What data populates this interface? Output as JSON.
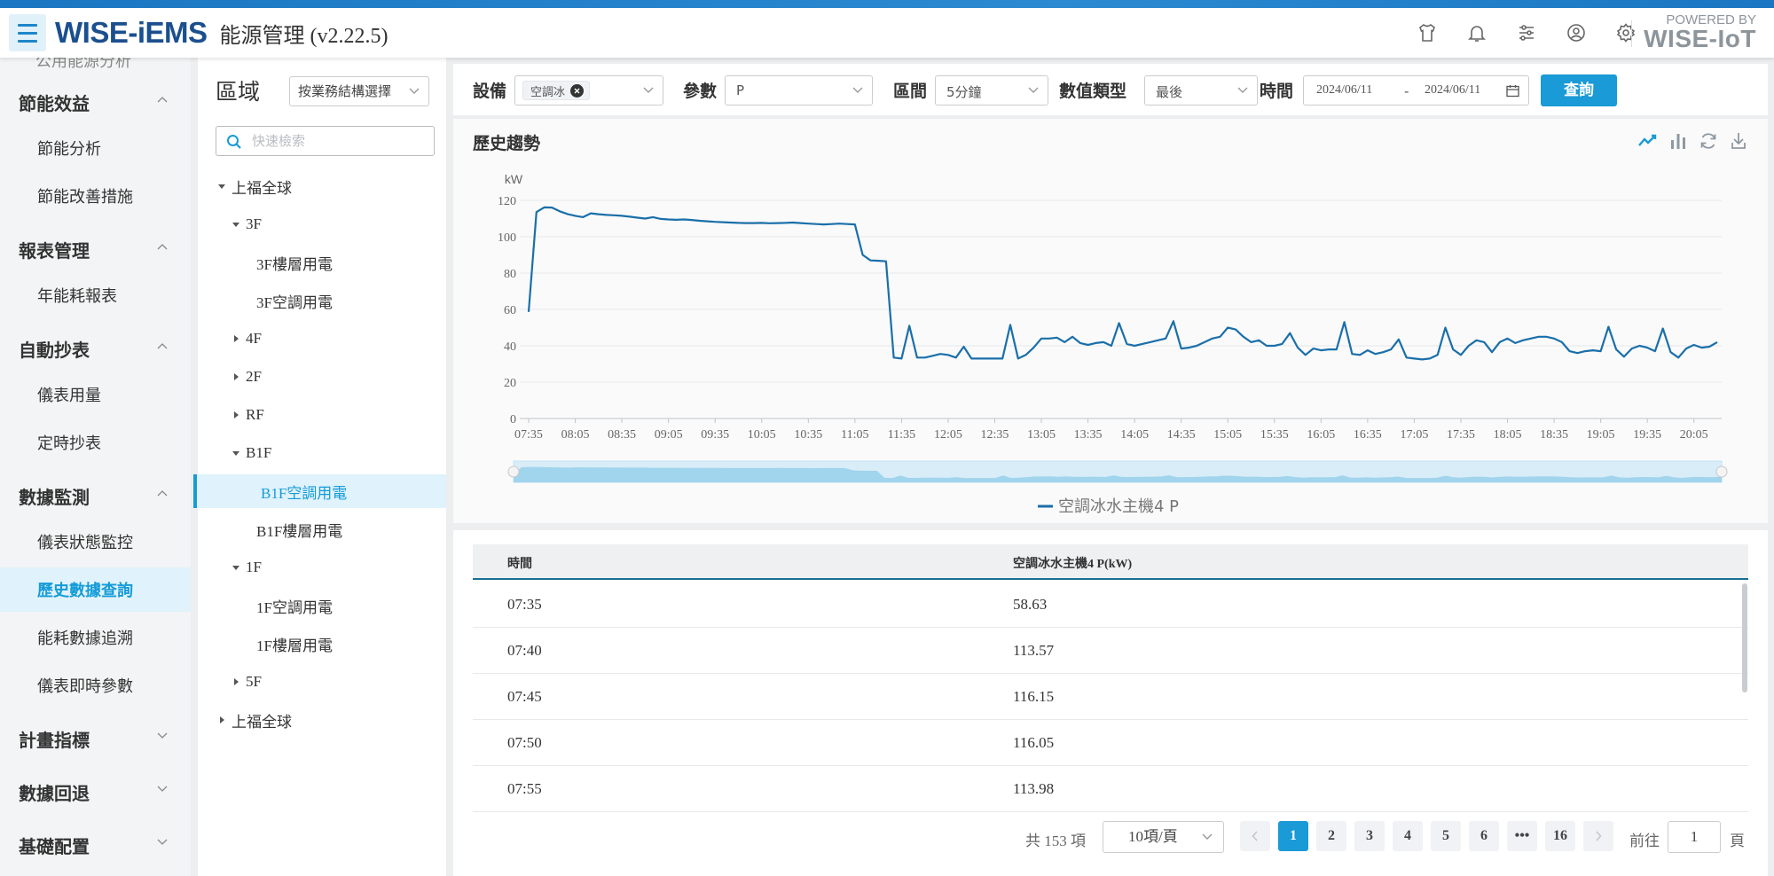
{
  "header": {
    "logo": "WISE-iEMS",
    "app_title": "能源管理 (v2.22.5)",
    "powered_line1": "POWERED BY",
    "powered_line2": "WISE-IoT"
  },
  "sidebar": {
    "cut_item": "公用能源分析",
    "sections": [
      {
        "label": "節能效益",
        "expanded": true,
        "items": [
          "節能分析",
          "節能改善措施"
        ]
      },
      {
        "label": "報表管理",
        "expanded": true,
        "items": [
          "年能耗報表"
        ]
      },
      {
        "label": "自動抄表",
        "expanded": true,
        "items": [
          "儀表用量",
          "定時抄表"
        ]
      },
      {
        "label": "數據監測",
        "expanded": true,
        "items": [
          "儀表狀態監控",
          "歷史數據查詢",
          "能耗數據追溯",
          "儀表即時參數"
        ]
      },
      {
        "label": "計畫指標",
        "expanded": false,
        "items": []
      },
      {
        "label": "數據回退",
        "expanded": false,
        "items": []
      },
      {
        "label": "基礎配置",
        "expanded": false,
        "items": []
      }
    ],
    "active_item": "歷史數據查詢"
  },
  "region": {
    "title": "區域",
    "select_value": "按業務結構選擇",
    "search_placeholder": "快速檢索",
    "tree": [
      {
        "label": "上福全球",
        "level": 0,
        "state": "expanded"
      },
      {
        "label": "3F",
        "level": 1,
        "state": "expanded"
      },
      {
        "label": "3F樓層用電",
        "level": 2,
        "state": "leaf"
      },
      {
        "label": "3F空調用電",
        "level": 2,
        "state": "leaf"
      },
      {
        "label": "4F",
        "level": 1,
        "state": "collapsed"
      },
      {
        "label": "2F",
        "level": 1,
        "state": "collapsed"
      },
      {
        "label": "RF",
        "level": 1,
        "state": "collapsed"
      },
      {
        "label": "B1F",
        "level": 1,
        "state": "expanded"
      },
      {
        "label": "B1F空調用電",
        "level": 2,
        "state": "leaf",
        "active": true
      },
      {
        "label": "B1F樓層用電",
        "level": 2,
        "state": "leaf"
      },
      {
        "label": "1F",
        "level": 1,
        "state": "expanded"
      },
      {
        "label": "1F空調用電",
        "level": 2,
        "state": "leaf"
      },
      {
        "label": "1F樓層用電",
        "level": 2,
        "state": "leaf"
      },
      {
        "label": "5F",
        "level": 1,
        "state": "collapsed"
      },
      {
        "label": "上福全球",
        "level": 0,
        "state": "collapsed"
      }
    ]
  },
  "filters": {
    "device_label": "設備",
    "device_tag": "空調冰",
    "param_label": "參數",
    "param_value": "P",
    "interval_label": "區間",
    "interval_value": "5分鐘",
    "value_type_label": "數值類型",
    "value_type_value": "最後",
    "time_label": "時間",
    "date_from": "2024/06/11",
    "date_sep": "-",
    "date_to": "2024/06/11",
    "query_button": "查詢"
  },
  "chart_card": {
    "title": "歷史趨勢",
    "tool_icons": [
      "line-chart-icon",
      "bar-chart-icon",
      "refresh-icon",
      "download-icon"
    ]
  },
  "chart_data": {
    "type": "line",
    "title": "",
    "ylabel": "kW",
    "xlabel": "",
    "ylim": [
      0,
      120
    ],
    "yticks": [
      0,
      20,
      40,
      60,
      80,
      100,
      120
    ],
    "xtick_labels": [
      "07:35",
      "08:05",
      "08:35",
      "09:05",
      "09:35",
      "10:05",
      "10:35",
      "11:05",
      "11:35",
      "12:05",
      "12:35",
      "13:05",
      "13:35",
      "14:05",
      "14:35",
      "15:05",
      "15:35",
      "16:05",
      "16:35",
      "17:05",
      "17:35",
      "18:05",
      "18:35",
      "19:05",
      "19:35",
      "20:05"
    ],
    "legend": "bottom-center",
    "grid": true,
    "series": [
      {
        "name": "空調冰水主機4 P",
        "color": "#1a6fa9",
        "start": "07:35",
        "step_minutes": 5,
        "values": [
          58.63,
          113.57,
          116.15,
          116.05,
          113.98,
          112.5,
          111.5,
          110.8,
          112.9,
          112.4,
          112.0,
          111.8,
          111.5,
          111.0,
          110.5,
          110.0,
          110.8,
          109.8,
          109.5,
          109.3,
          109.5,
          109.2,
          108.8,
          108.5,
          108.2,
          108.0,
          107.8,
          107.6,
          107.5,
          107.5,
          107.6,
          107.4,
          107.5,
          107.6,
          107.8,
          107.5,
          107.2,
          107.0,
          106.8,
          107.0,
          107.2,
          107.0,
          106.8,
          90.0,
          87.0,
          86.8,
          86.5,
          33.5,
          33.0,
          51.0,
          33.5,
          33.5,
          34.5,
          35.5,
          35.0,
          33.5,
          39.5,
          33.0,
          33.0,
          33.0,
          33.0,
          33.0,
          51.5,
          33.0,
          35.0,
          39.0,
          44.0,
          44.0,
          44.5,
          42.0,
          45.0,
          41.5,
          40.5,
          41.5,
          42.0,
          40.0,
          52.5,
          41.0,
          40.0,
          41.0,
          42.0,
          43.0,
          44.0,
          53.5,
          38.5,
          39.0,
          40.0,
          42.0,
          44.0,
          45.0,
          50.0,
          49.0,
          45.0,
          42.0,
          43.0,
          40.0,
          40.0,
          41.0,
          47.0,
          39.0,
          35.0,
          38.5,
          37.5,
          38.0,
          38.0,
          53.0,
          35.5,
          35.0,
          37.5,
          35.5,
          36.5,
          38.0,
          43.5,
          33.5,
          33.0,
          32.5,
          33.0,
          35.0,
          50.0,
          38.0,
          35.0,
          40.0,
          43.0,
          42.0,
          36.5,
          42.0,
          44.0,
          41.5,
          43.0,
          44.0,
          45.0,
          45.0,
          44.0,
          42.0,
          37.0,
          36.0,
          37.0,
          37.5,
          37.0,
          50.5,
          38.0,
          34.0,
          38.5,
          40.0,
          39.0,
          37.0,
          49.5,
          36.5,
          33.5,
          38.5,
          40.5,
          39.0,
          39.5,
          42.0
        ]
      }
    ]
  },
  "table": {
    "col_time": "時間",
    "col_value": "空調冰水主機4 P(kW)",
    "rows": [
      {
        "time": "07:35",
        "value": "58.63"
      },
      {
        "time": "07:40",
        "value": "113.57"
      },
      {
        "time": "07:45",
        "value": "116.15"
      },
      {
        "time": "07:50",
        "value": "116.05"
      },
      {
        "time": "07:55",
        "value": "113.98"
      }
    ]
  },
  "pagination": {
    "total": "共 153 項",
    "page_size": "10項/頁",
    "pages": [
      "1",
      "2",
      "3",
      "4",
      "5",
      "6",
      "•••",
      "16"
    ],
    "current": "1",
    "goto_label": "前往",
    "goto_value": "1",
    "page_suffix": "頁"
  }
}
